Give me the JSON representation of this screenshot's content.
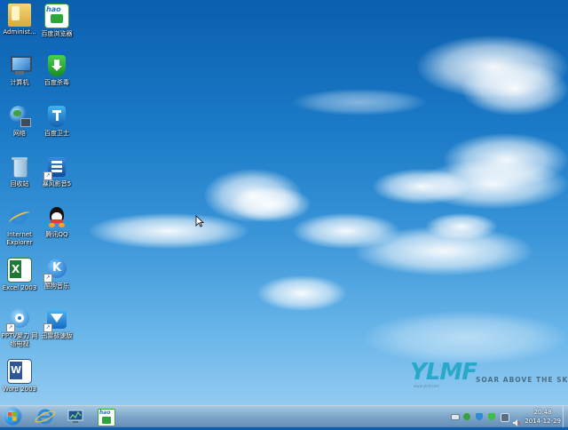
{
  "desktop": {
    "icons": [
      {
        "label": "Administ...",
        "icon": "folder-icon"
      },
      {
        "label": "百度浏览器",
        "icon": "hao123-browser-icon"
      },
      {
        "label": "计算机",
        "icon": "computer-icon"
      },
      {
        "label": "百度杀毒",
        "icon": "baidu-antivirus-icon"
      },
      {
        "label": "网络",
        "icon": "network-icon"
      },
      {
        "label": "百度卫士",
        "icon": "baidu-guard-icon"
      },
      {
        "label": "回收站",
        "icon": "recycle-bin-icon"
      },
      {
        "label": "暴风影音5",
        "icon": "storm-player-icon"
      },
      {
        "label": "Internet Explorer",
        "icon": "internet-explorer-icon"
      },
      {
        "label": "腾讯QQ",
        "icon": "qq-icon"
      },
      {
        "label": "Excel 2003",
        "icon": "excel-icon"
      },
      {
        "label": "酷狗音乐",
        "icon": "kugou-icon"
      },
      {
        "label": "PPTV聚力 网络电视",
        "icon": "pptv-icon"
      },
      {
        "label": "迅雷极速版",
        "icon": "xunlei-icon"
      },
      {
        "label": "Word 2003",
        "icon": "word-icon"
      }
    ]
  },
  "wallpaper": {
    "brand": "YLMF",
    "tagline": "SOAR ABOVE THE SKY",
    "url": "www.ylmf.com"
  },
  "taskbar": {
    "pinned": [
      "internet-explorer-icon",
      "network-monitor-icon",
      "hao123-browser-icon"
    ],
    "pinned_text": "hao",
    "tray_icons": [
      "keyboard-icon",
      "network-icon",
      "baidu-guard-icon",
      "antivirus-icon",
      "monitor-icon",
      "volume-icon"
    ],
    "clock_time": "20:48",
    "clock_date": "2014-12-29"
  },
  "colors": {
    "sky_top": "#0a5fae",
    "sky_bottom": "#9fd0f3",
    "logo": "#2aa8c9"
  }
}
